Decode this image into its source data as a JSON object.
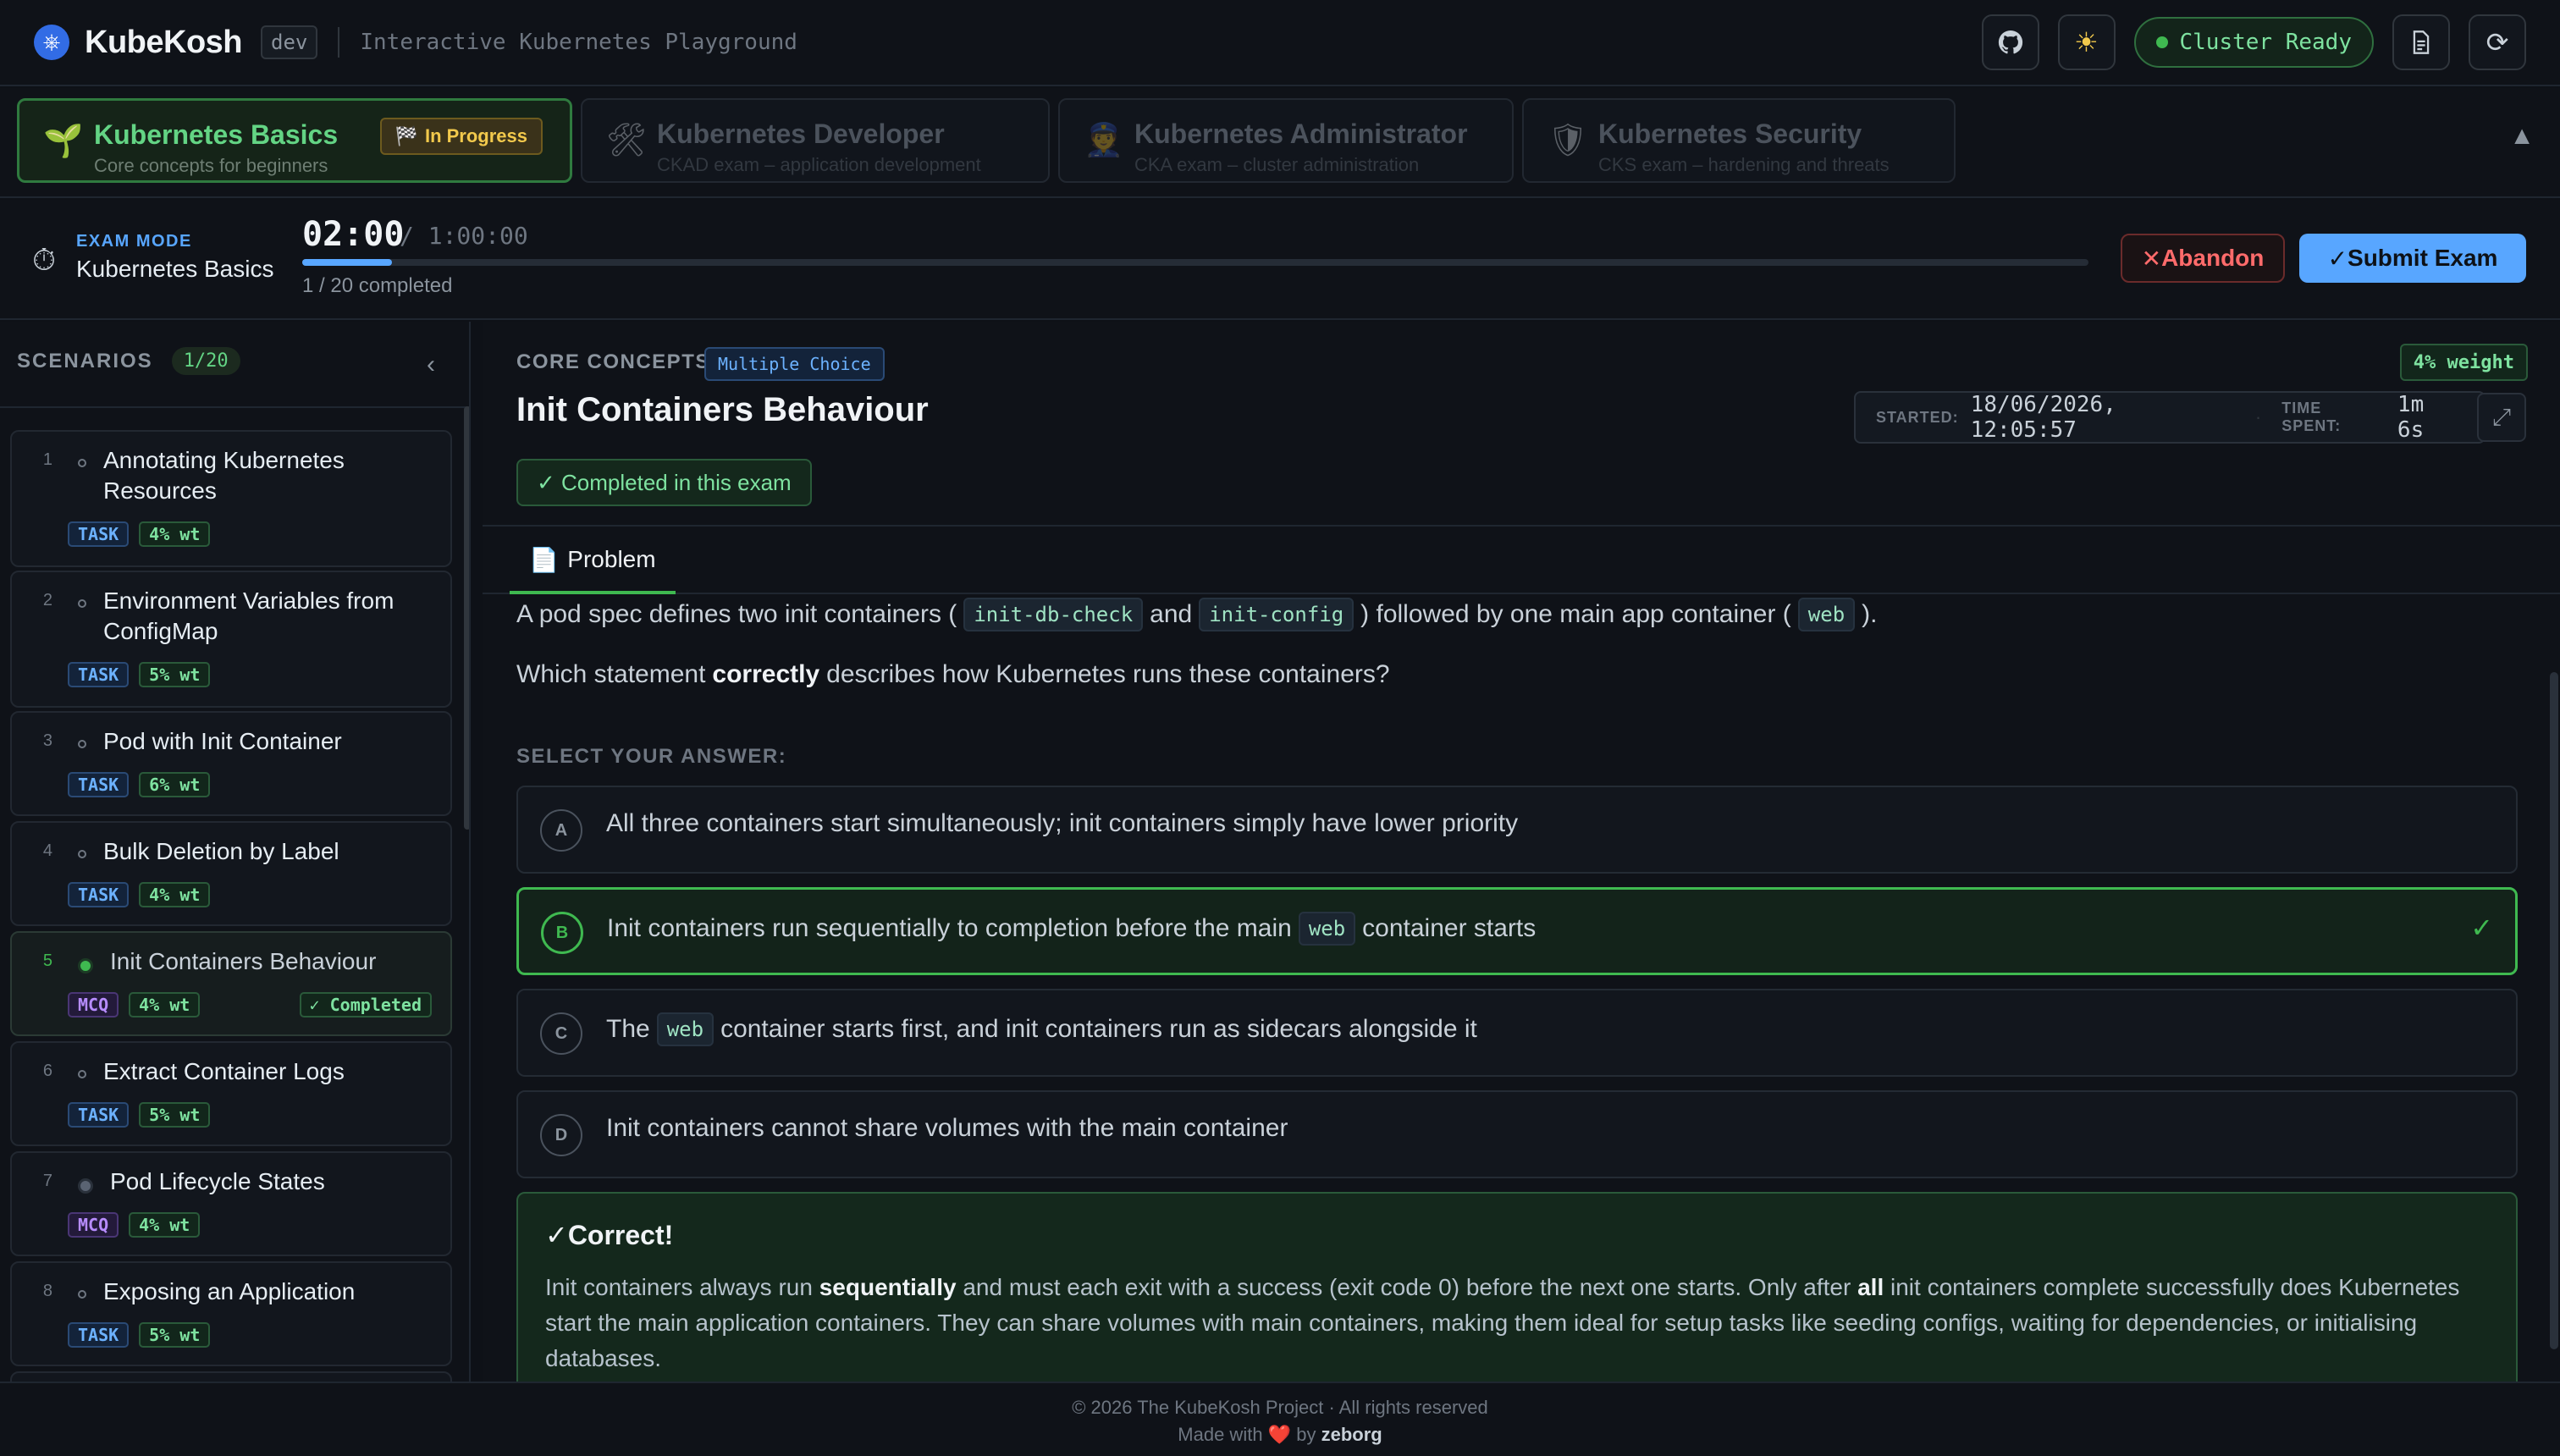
{
  "header": {
    "brand": "KubeKosh",
    "env": "dev",
    "tagline": "Interactive Kubernetes Playground",
    "cluster_status": "Cluster Ready",
    "icons": [
      "github-icon",
      "sun-icon",
      "document-icon",
      "refresh-icon"
    ]
  },
  "tracks": [
    {
      "title": "Kubernetes Basics",
      "subtitle": "Core concepts for beginners",
      "badge": "In Progress",
      "icon": "seedling-icon"
    },
    {
      "title": "Kubernetes Developer",
      "subtitle": "CKAD exam – application development",
      "icon": "tools-icon"
    },
    {
      "title": "Kubernetes Administrator",
      "subtitle": "CKA exam – cluster administration",
      "icon": "admin-icon"
    },
    {
      "title": "Kubernetes Security",
      "subtitle": "CKS exam – hardening and threats",
      "icon": "shield-icon"
    }
  ],
  "exam": {
    "mode_label": "EXAM MODE",
    "track": "Kubernetes Basics",
    "elapsed": "02:00",
    "total": "/ 1:00:00",
    "progress_fraction": 0.05,
    "completed": "1 / 20 completed",
    "abandon_label": "Abandon",
    "submit_label": "Submit Exam"
  },
  "sidebar": {
    "title": "SCENARIOS",
    "count": "1/20",
    "items": [
      {
        "num": "1",
        "title": "Annotating Kubernetes Resources",
        "type": "TASK",
        "weight": "4% wt"
      },
      {
        "num": "2",
        "title": "Environment Variables from ConfigMap",
        "type": "TASK",
        "weight": "5% wt"
      },
      {
        "num": "3",
        "title": "Pod with Init Container",
        "type": "TASK",
        "weight": "6% wt"
      },
      {
        "num": "4",
        "title": "Bulk Deletion by Label",
        "type": "TASK",
        "weight": "4% wt"
      },
      {
        "num": "5",
        "title": "Init Containers Behaviour",
        "type": "MCQ",
        "weight": "4% wt",
        "status": "✓ Completed"
      },
      {
        "num": "6",
        "title": "Extract Container Logs",
        "type": "TASK",
        "weight": "5% wt"
      },
      {
        "num": "7",
        "title": "Pod Lifecycle States",
        "type": "MCQ",
        "weight": "4% wt"
      },
      {
        "num": "8",
        "title": "Exposing an Application",
        "type": "TASK",
        "weight": "5% wt"
      }
    ]
  },
  "question": {
    "category": "CORE CONCEPTS",
    "type_badge": "Multiple Choice",
    "weight": "4% weight",
    "title": "Init Containers Behaviour",
    "started_label": "STARTED:",
    "started": "18/06/2026, 12:05:57",
    "time_spent_label": "TIME SPENT:",
    "time_spent": "1m 6s",
    "completed_badge": "✓ Completed in this exam",
    "tab": "Problem",
    "p1": {
      "a": "A pod spec defines two init containers (",
      "c1": "init-db-check",
      "b": "and",
      "c2": "init-config",
      "c": ") followed by one main app container (",
      "c3": "web",
      "d": ")."
    },
    "p2": {
      "a": "Which statement",
      "b": "correctly",
      "c": "describes how Kubernetes runs these containers?"
    },
    "select_label": "SELECT YOUR ANSWER:",
    "options": [
      {
        "letter": "A",
        "text": "All three containers start simultaneously; init containers simply have lower priority"
      },
      {
        "letter": "B",
        "pre": "Init containers run sequentially to completion before the main",
        "code": "web",
        "post": "container starts"
      },
      {
        "letter": "C",
        "pre": "The",
        "code": "web",
        "post": "container starts first, and init containers run as sidecars alongside it"
      },
      {
        "letter": "D",
        "text": "Init containers cannot share volumes with the main container"
      }
    ],
    "feedback": {
      "title": "✓Correct!",
      "t1": "Init containers always run",
      "b1": "sequentially",
      "t2": "and must each exit with a success (exit code 0) before the next one starts. Only after",
      "b2": "all",
      "t3": "init containers complete successfully does Kubernetes start the main application containers. They can share volumes with main containers, making them ideal for setup tasks like seeding configs, waiting for dependencies, or initialising databases."
    }
  },
  "footer": {
    "line1": "© 2026 The KubeKosh Project · All rights reserved",
    "made_with": "Made with",
    "heart": "❤️",
    "by": "by",
    "author": "zeborg"
  },
  "colors": {
    "accent_green": "#3fb950",
    "accent_blue": "#58a6ff",
    "danger": "#ff6b6b",
    "badge_yellow": "#f2c94c"
  }
}
